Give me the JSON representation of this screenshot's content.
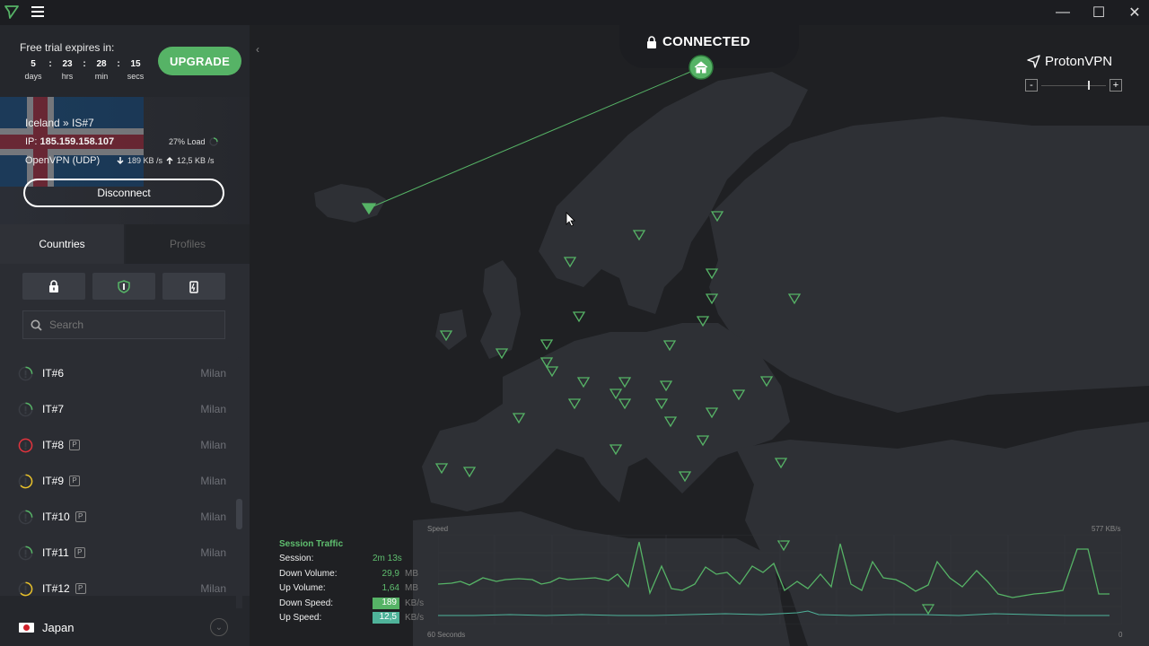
{
  "titlebar": {
    "minimize": "—",
    "maximize": "☐",
    "close": "✕"
  },
  "trial": {
    "label": "Free trial expires in:",
    "days": "5",
    "days_unit": "days",
    "hrs": "23",
    "hrs_unit": "hrs",
    "min": "28",
    "min_unit": "min",
    "secs": "15",
    "secs_unit": "secs",
    "sep": ":",
    "upgrade_label": "UPGRADE"
  },
  "connection": {
    "server": "Iceland » IS#7",
    "ip_label": "IP:",
    "ip": "185.159.158.107",
    "load": "27% Load",
    "protocol": "OpenVPN (UDP)",
    "down_speed": "189 KB /s",
    "up_speed": "12,5 KB /s",
    "disconnect_label": "Disconnect"
  },
  "tabs": {
    "countries": "Countries",
    "profiles": "Profiles"
  },
  "search": {
    "placeholder": "Search"
  },
  "servers": [
    {
      "name": "IT#6",
      "city": "Milan",
      "plus": false,
      "load": "low"
    },
    {
      "name": "IT#7",
      "city": "Milan",
      "plus": false,
      "load": "low"
    },
    {
      "name": "IT#8",
      "city": "Milan",
      "plus": true,
      "load": "high"
    },
    {
      "name": "IT#9",
      "city": "Milan",
      "plus": true,
      "load": "medium"
    },
    {
      "name": "IT#10",
      "city": "Milan",
      "plus": true,
      "load": "low"
    },
    {
      "name": "IT#11",
      "city": "Milan",
      "plus": true,
      "load": "low"
    },
    {
      "name": "IT#12",
      "city": "Milan",
      "plus": true,
      "load": "medium"
    }
  ],
  "plus_badge": "P",
  "country_row": {
    "name": "Japan"
  },
  "map": {
    "status": "CONNECTED",
    "brand": "ProtonVPN",
    "zoom_minus": "-",
    "zoom_plus": "+",
    "accent": "#56b366"
  },
  "traffic": {
    "title": "Session Traffic",
    "session_label": "Session:",
    "session_value": "2m 13s",
    "down_volume_label": "Down Volume:",
    "down_volume_value": "29,9",
    "down_volume_unit": "MB",
    "up_volume_label": "Up Volume:",
    "up_volume_value": "1,64",
    "up_volume_unit": "MB",
    "down_speed_label": "Down Speed:",
    "down_speed_value": "189",
    "down_speed_unit": "KB/s",
    "up_speed_label": "Up Speed:",
    "up_speed_value": "12,5",
    "up_speed_unit": "KB/s",
    "chart_speed_label": "Speed",
    "chart_max_label": "577 KB/s",
    "chart_time_label": "60 Seconds",
    "chart_zero_label": "0"
  }
}
